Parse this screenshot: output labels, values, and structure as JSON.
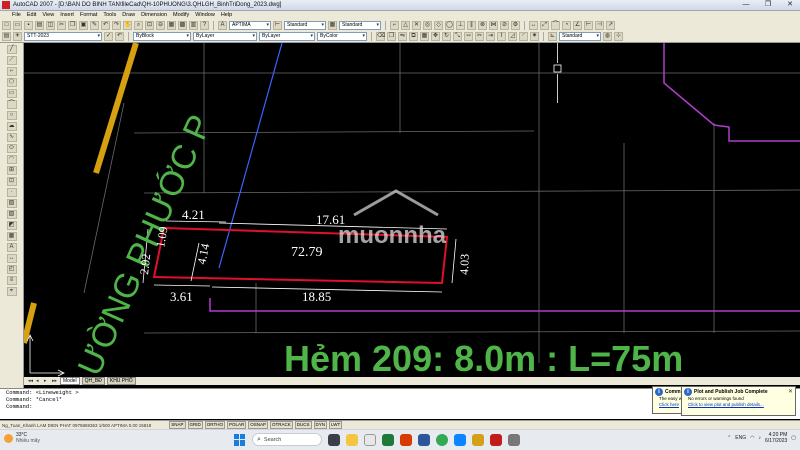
{
  "window": {
    "title": "AutoCAD 2007 - [D:\\BAN DO BINH TAN\\fileCad\\QH-10PHUONG\\3.QHLGH_BinhTriDong_2023.dwg]",
    "controls": [
      "—",
      "❐",
      "✕"
    ]
  },
  "menu": [
    "File",
    "Edit",
    "View",
    "Insert",
    "Format",
    "Tools",
    "Draw",
    "Dimension",
    "Modify",
    "Window",
    "Help"
  ],
  "toolbar": {
    "text_style": "APTIMA",
    "dim_style": "Standard",
    "table_style": "Standard",
    "layer": "STT-2023",
    "color": "ByBlock",
    "linetype": "ByLayer",
    "lineweight": "ByLayer",
    "plot_style": "ByColor",
    "ucs": "Standard"
  },
  "drawing": {
    "street_label": "ƯỜNG PHƯỚC P",
    "alley_label": "Hẻm 209:  8.0m : L=75m",
    "watermark": "muonnha",
    "dimensions": {
      "top_left": "4.21",
      "top": "17.61",
      "right": "4.03",
      "bottom": "18.85",
      "bottom_left": "3.61",
      "left": "2.92",
      "left_small": "1.09",
      "inner": "4.14",
      "area": "72.79"
    }
  },
  "tabs": {
    "nav": [
      "◂◂",
      "◂",
      "▸",
      "▸▸"
    ],
    "items": [
      "Model",
      "QH_BĐ",
      "KHU PHỐ"
    ]
  },
  "command": {
    "lines": [
      "Command: <Lineweight >",
      "Command: *Cancel*",
      "Command:"
    ]
  },
  "status": {
    "coords": "Ng_Tuan_Khanh LAM DIEN PHAT 0975869363 1/500  APTIMA  0.00  15818",
    "buttons": [
      "SNAP",
      "GRID",
      "ORTHO",
      "POLAR",
      "OSNAP",
      "OTRACK",
      "DUCS",
      "DYN",
      "LWT"
    ]
  },
  "notifications": {
    "left": {
      "title": "Comm",
      "line1": "The easy w",
      "link": "Click here"
    },
    "right": {
      "title": "Plot and Publish Job Complete",
      "line1": "No errors or warnings found",
      "link": "Click to view plot and publish details..."
    }
  },
  "taskbar": {
    "temp": "33°C",
    "weather_desc": "Nhiều mây",
    "search": "Search",
    "lang": "ENG",
    "time": "4:20 PM",
    "date": "6/17/2023"
  },
  "colors": {
    "lot_outline": "#e0102a",
    "dimension": "#ffffff",
    "road_edge": "#d6a010",
    "blue_line": "#3c64ff",
    "purple_line": "#b03cd0",
    "text_green": "#4fb548"
  }
}
